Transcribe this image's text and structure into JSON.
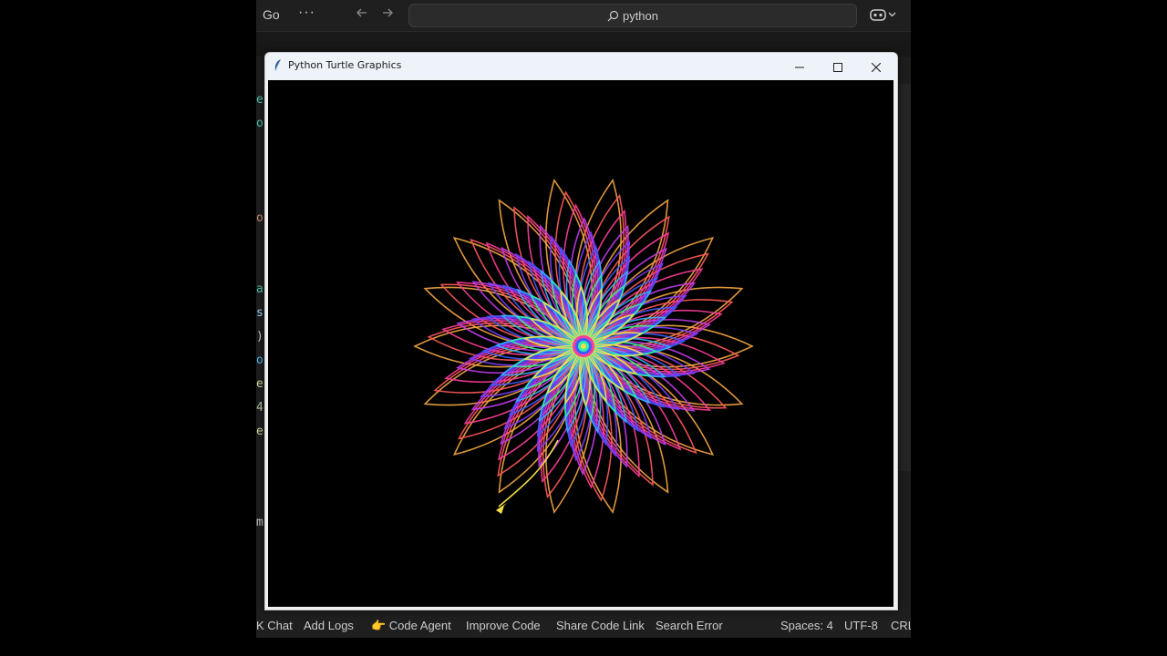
{
  "ide": {
    "menu_label": "Go",
    "more_label": "···",
    "back_icon": "arrow-left-icon",
    "forward_icon": "arrow-right-icon",
    "search_text": "python",
    "copilot_icon": "copilot-icon",
    "code_fragments": [
      {
        "text": "e",
        "color": "#4ec9b0"
      },
      {
        "text": "o",
        "color": "#4ec9b0"
      },
      {
        "text": "o",
        "color": "#ce9178"
      },
      {
        "text": "a",
        "color": "#4ec9b0"
      },
      {
        "text": "s",
        "color": "#9cdcfe"
      },
      {
        "text": ")",
        "color": "#d4d4d4"
      },
      {
        "text": "o",
        "color": "#4fc1ff"
      },
      {
        "text": "e",
        "color": "#dcdcaa"
      },
      {
        "text": "4",
        "color": "#b5cea8"
      },
      {
        "text": "e",
        "color": "#dcdcaa"
      },
      {
        "text": "m",
        "color": "#d4d4d4"
      }
    ],
    "statusbar": {
      "items": [
        "K Chat",
        "Add Logs",
        "👉 Code Agent",
        "Improve Code",
        "Share Code Link",
        "Search Error"
      ],
      "spaces": "Spaces: 4",
      "encoding": "UTF-8",
      "eol": "CRL"
    }
  },
  "turtle_window": {
    "title": "Python Turtle Graphics",
    "minimize_icon": "minimize-icon",
    "maximize_icon": "maximize-icon",
    "close_icon": "close-icon",
    "canvas_background": "#000000",
    "pattern": {
      "petals": 18,
      "layers": 9,
      "colors": [
        "#f5a742",
        "#ff5a5a",
        "#ff3d9a",
        "#c63cf0",
        "#7a3cff",
        "#3d5cff",
        "#31b4ff",
        "#2ef0a8",
        "#f6e04a"
      ],
      "center_colors": [
        "#ff3d9a",
        "#3d5cff",
        "#2ef0a8",
        "#f6e04a"
      ],
      "turtle_color": "#f6e04a"
    }
  }
}
